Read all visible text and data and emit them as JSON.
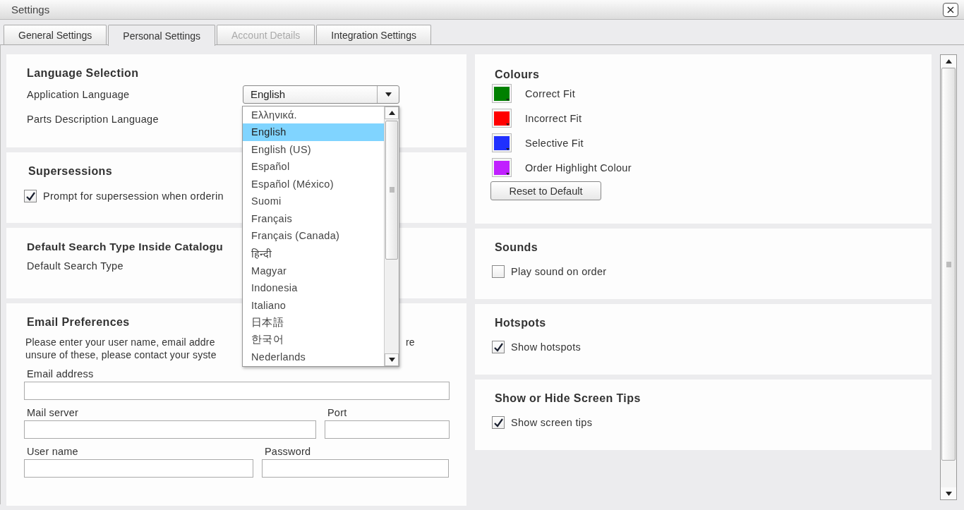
{
  "window": {
    "title": "Settings",
    "close_label": "×"
  },
  "tabs": [
    {
      "label": "General Settings",
      "selected": false,
      "disabled": false
    },
    {
      "label": "Personal Settings",
      "selected": true,
      "disabled": false
    },
    {
      "label": "Account Details",
      "selected": false,
      "disabled": true
    },
    {
      "label": "Integration Settings",
      "selected": false,
      "disabled": false
    }
  ],
  "language_selection": {
    "heading": "Language Selection",
    "application_language_label": "Application Language",
    "parts_description_language_label": "Parts Description Language",
    "dropdown": {
      "value": "English",
      "options": [
        {
          "label": "Ελληνικά.",
          "selected": false
        },
        {
          "label": "English",
          "selected": true
        },
        {
          "label": "English (US)",
          "selected": false
        },
        {
          "label": "Español",
          "selected": false
        },
        {
          "label": "Español (México)",
          "selected": false
        },
        {
          "label": "Suomi",
          "selected": false
        },
        {
          "label": "Français",
          "selected": false
        },
        {
          "label": "Français (Canada)",
          "selected": false
        },
        {
          "label": "हिन्दी",
          "selected": false
        },
        {
          "label": "Magyar",
          "selected": false
        },
        {
          "label": "Indonesia",
          "selected": false
        },
        {
          "label": "Italiano",
          "selected": false
        },
        {
          "label": "日本語",
          "selected": false
        },
        {
          "label": "한국어",
          "selected": false
        },
        {
          "label": "Nederlands",
          "selected": false
        }
      ]
    }
  },
  "supersessions": {
    "heading": "Supersessions",
    "checkbox": {
      "label": "Prompt for supersession when orderin",
      "checked": true
    }
  },
  "default_search": {
    "heading": "Default Search Type Inside Catalogu",
    "label": "Default Search Type"
  },
  "email_preferences": {
    "heading": "Email Preferences",
    "description_line_1": "Please enter your user name, email addre",
    "description_line_1_end": "re",
    "description_line_2": "unsure of these, please contact your syste",
    "email_address_label": "Email address",
    "mail_server_label": "Mail server",
    "port_label": "Port",
    "user_name_label": "User name",
    "password_label": "Password"
  },
  "colours": {
    "heading": "Colours",
    "items": [
      {
        "label": "Correct Fit",
        "color": "#008000"
      },
      {
        "label": "Incorrect Fit",
        "color": "#ff0000"
      },
      {
        "label": "Selective Fit",
        "color": "#2030ff"
      },
      {
        "label": "Order Highlight Colour",
        "color": "#c020ff"
      }
    ],
    "reset_button": "Reset to Default"
  },
  "sounds": {
    "heading": "Sounds",
    "checkbox": {
      "label": "Play sound on order",
      "checked": false
    }
  },
  "hotspots": {
    "heading": "Hotspots",
    "checkbox": {
      "label": "Show hotspots",
      "checked": true
    }
  },
  "screen_tips": {
    "heading": "Show or Hide Screen Tips",
    "checkbox": {
      "label": "Show screen tips",
      "checked": true
    }
  }
}
